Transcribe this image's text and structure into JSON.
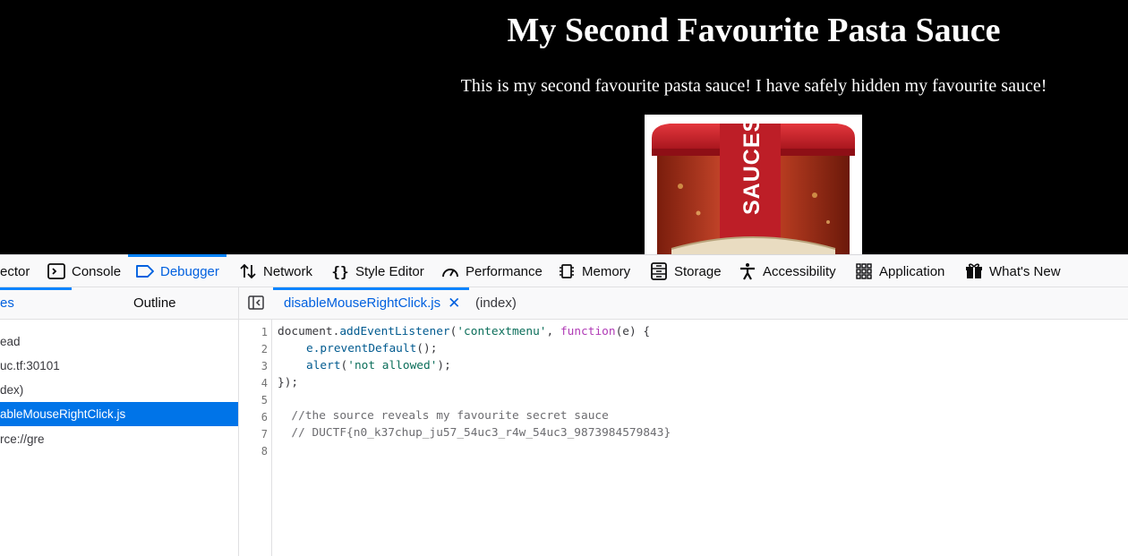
{
  "webpage": {
    "title": "My Second Favourite Pasta Sauce",
    "description": "This is my second favourite pasta sauce! I have safely hidden my favourite sauce!",
    "jar_label": "SAUCES"
  },
  "devtools": {
    "tabs": [
      {
        "label": "ector",
        "icon": "inspector-icon"
      },
      {
        "label": "Console",
        "icon": "console-icon"
      },
      {
        "label": "Debugger",
        "icon": "debugger-icon",
        "active": true
      },
      {
        "label": "Network",
        "icon": "network-icon"
      },
      {
        "label": "Style Editor",
        "icon": "style-editor-icon"
      },
      {
        "label": "Performance",
        "icon": "performance-icon"
      },
      {
        "label": "Memory",
        "icon": "memory-icon"
      },
      {
        "label": "Storage",
        "icon": "storage-icon"
      },
      {
        "label": "Accessibility",
        "icon": "accessibility-icon"
      },
      {
        "label": "Application",
        "icon": "application-icon"
      },
      {
        "label": "What's New",
        "icon": "whats-new-icon"
      }
    ],
    "sidebar": {
      "tabs": {
        "sources": "es",
        "outline": "Outline"
      },
      "tree": [
        "ead",
        "uc.tf:30101",
        "dex)",
        "ableMouseRightClick.js",
        "rce://gre"
      ]
    },
    "editor": {
      "tabs": [
        {
          "label": "disableMouseRightClick.js",
          "active": true
        },
        {
          "label": "(index)"
        }
      ],
      "line_numbers": [
        "1",
        "2",
        "3",
        "4",
        "5",
        "6",
        "7",
        "8"
      ],
      "code": {
        "l1_obj": "document.",
        "l1_fn": "addEventListener",
        "l1_open": "(",
        "l1_str": "'contextmenu'",
        "l1_comma": ", ",
        "l1_kw": "function",
        "l1_rest": "(e) {",
        "l2_var": "e.",
        "l2_fn": "preventDefault",
        "l2_rest": "();",
        "l3_fn": "alert",
        "l3_open": "(",
        "l3_str": "'not allowed'",
        "l3_rest": ");",
        "l4": "});",
        "l6": "  //the source reveals my favourite secret sauce",
        "l7": "  // DUCTF{n0_k37chup_ju57_54uc3_r4w_54uc3_9873984579843}"
      }
    }
  },
  "colors": {
    "accent": "#0a84ff",
    "active_text": "#0060df",
    "selection": "#0074e8",
    "jar_red": "#c8202a"
  }
}
